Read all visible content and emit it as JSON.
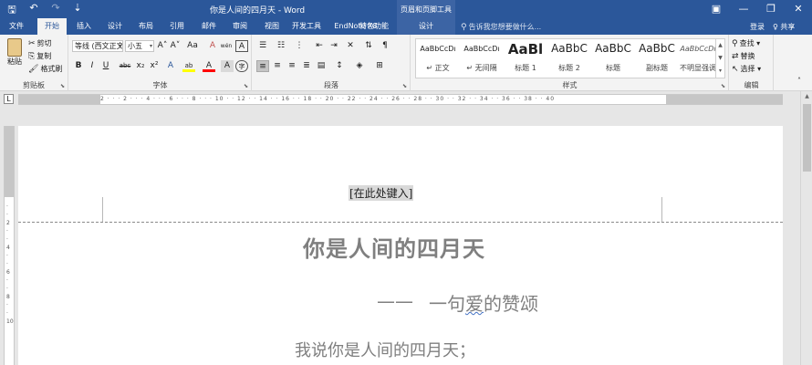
{
  "titlebar": {
    "qat": [
      {
        "name": "save-icon",
        "glyph": "🖫"
      },
      {
        "name": "undo-icon",
        "glyph": "↶"
      },
      {
        "name": "redo-icon",
        "glyph": "↷"
      },
      {
        "name": "customize-qat-icon",
        "glyph": "⇣"
      }
    ],
    "title": "你是人间的四月天 - Word",
    "context_group": "页眉和页脚工具",
    "window_buttons": [
      "▣",
      "—",
      "❐",
      "✕"
    ]
  },
  "tabs": [
    {
      "label": "文件",
      "active": false
    },
    {
      "label": "开始",
      "active": true
    },
    {
      "label": "插入",
      "active": false
    },
    {
      "label": "设计",
      "active": false
    },
    {
      "label": "布局",
      "active": false
    },
    {
      "label": "引用",
      "active": false
    },
    {
      "label": "邮件",
      "active": false
    },
    {
      "label": "审阅",
      "active": false
    },
    {
      "label": "视图",
      "active": false
    },
    {
      "label": "开发工具",
      "active": false
    },
    {
      "label": "EndNote X8",
      "active": false
    },
    {
      "label": "特色功能",
      "active": false
    },
    {
      "label": "设计",
      "active": false,
      "contextual": true
    }
  ],
  "tell_me": "告诉我您想要做什么...",
  "sign_in": "登录",
  "share": "♀ 共享",
  "ribbon": {
    "clipboard": {
      "paste": "粘贴",
      "cut": "剪切",
      "copy": "复制",
      "format_painter": "格式刷",
      "label": "剪贴板"
    },
    "font": {
      "font_name": "等线 (西文正文)",
      "font_size": "小五",
      "grow": "A˄",
      "shrink": "A˅",
      "case": "Aa",
      "clear": "A",
      "phonetic": "wén",
      "border": "A",
      "bold": "B",
      "italic": "I",
      "underline": "U",
      "strike": "abc",
      "subscript": "x₂",
      "superscript": "x²",
      "effects": "A",
      "highlight": "ab",
      "color": "A",
      "shading": "A",
      "enclose": "字",
      "label": "字体"
    },
    "paragraph": {
      "label": "段落"
    },
    "styles": {
      "items": [
        {
          "preview": "AaBbCcDı",
          "name": "↵ 正文"
        },
        {
          "preview": "AaBbCcDı",
          "name": "↵ 无间隔"
        },
        {
          "preview": "AaBl",
          "name": "标题 1"
        },
        {
          "preview": "AaBbC",
          "name": "标题 2"
        },
        {
          "preview": "AaBbC",
          "name": "标题"
        },
        {
          "preview": "AaBbC",
          "name": "副标题"
        },
        {
          "preview": "AaBbCcDı",
          "name": "不明显强调"
        }
      ],
      "label": "样式"
    },
    "editing": {
      "find": "查找",
      "replace": "替换",
      "select": "选择",
      "label": "编辑"
    }
  },
  "hruler_numbers": "2  ·  ·  ·  2  ·  ·  ·  4  ·  ·  ·  6  ·  ·  ·  8  ·  ·  ·  10  ·  ·  12  ·  ·  14  ·  ·  16  ·  ·  18  ·  ·  20  ·  ·  22  ·  ·  24  ·  ·  26  ·  ·  28  ·  ·  30  ·  ·  32  ·  ·  34  ·  ·  36  ·  ·  38  ·  ·  40",
  "document": {
    "header_placeholder": "[在此处键入]",
    "title": "你是人间的四月天",
    "dash": "——",
    "subtitle_pre": "一句",
    "subtitle_squiggle": "爱",
    "subtitle_post": "的赞颂",
    "line1": "我说你是人间的四月天；"
  },
  "colors": {
    "brand": "#2b579a",
    "ribbon_bg": "#f3f3f3",
    "text_gray": "#7f7f7f"
  }
}
